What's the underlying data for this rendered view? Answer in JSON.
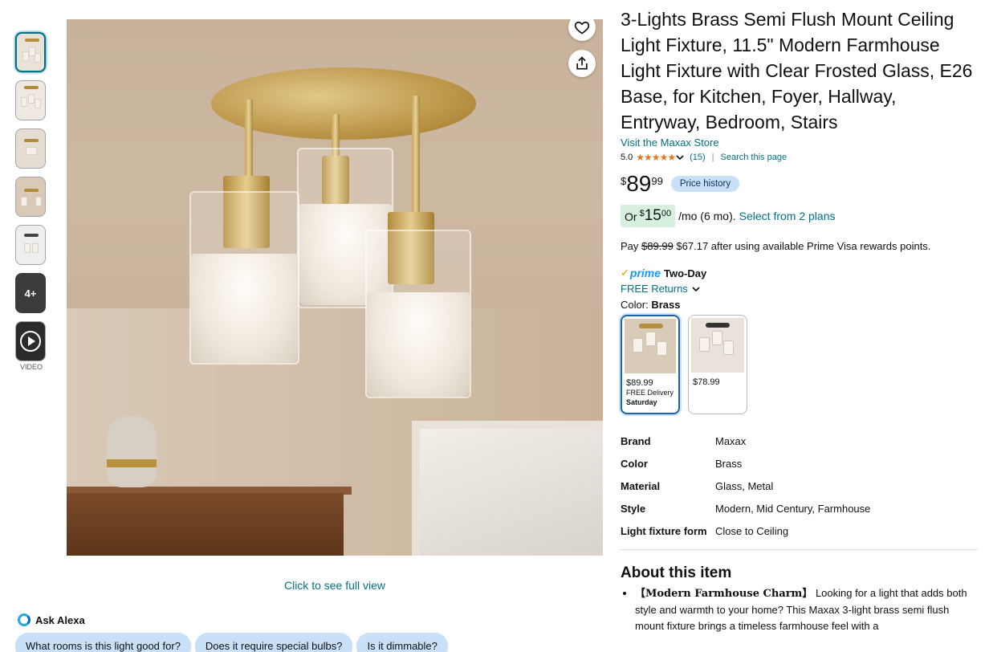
{
  "gallery": {
    "thumbnail_more": "4+",
    "video_label": "VIDEO",
    "full_view_link": "Click to see full view"
  },
  "alexa": {
    "title": "Ask Alexa",
    "questions": [
      "What rooms is this light good for?",
      "Does it require special bulbs?",
      "Is it dimmable?"
    ]
  },
  "product": {
    "title": "3-Lights Brass Semi Flush Mount Ceiling Light Fixture, 11.5\" Modern Farmhouse Light Fixture with Clear Frosted Glass, E26 Base, for Kitchen, Foyer, Hallway, Entryway, Bedroom, Stairs",
    "store_link": "Visit the Maxax Store",
    "rating": "5.0",
    "stars": "★★★★★",
    "rating_count": "(15)",
    "search_link": "Search this page"
  },
  "price": {
    "symbol": "$",
    "whole": "89",
    "fraction": "99",
    "history_button": "Price history"
  },
  "plan": {
    "or": "Or",
    "symbol": "$",
    "whole": "15",
    "fraction": "00",
    "rest": "/mo (6 mo).",
    "link": "Select from 2 plans"
  },
  "prime_rewards": {
    "pay": "Pay",
    "original": "$89.99",
    "after": "$67.17 after using available Prime Visa rewards points."
  },
  "delivery": {
    "prime_label": "prime",
    "speed": "Two-Day",
    "returns": "FREE Returns"
  },
  "color": {
    "label": "Color:",
    "value": "Brass",
    "options": [
      {
        "price": "$89.99",
        "delivery": "FREE Delivery",
        "day": "Saturday"
      },
      {
        "price": "$78.99",
        "delivery": "",
        "day": ""
      }
    ]
  },
  "specs": [
    {
      "key": "Brand",
      "value": "Maxax"
    },
    {
      "key": "Color",
      "value": "Brass"
    },
    {
      "key": "Material",
      "value": "Glass, Metal"
    },
    {
      "key": "Style",
      "value": "Modern, Mid Century, Farmhouse"
    },
    {
      "key": "Light fixture form",
      "value": "Close to Ceiling"
    }
  ],
  "about": {
    "title": "About this item",
    "bullets": [
      {
        "head": "【Modern Farmhouse Charm】",
        "text": "Looking for a light that adds both style and warmth to your home? This Maxax 3-light brass semi flush mount fixture brings a timeless farmhouse feel with a"
      }
    ]
  },
  "colors": {
    "link": "#007185",
    "price_history_bg": "#c8e0f8",
    "plan_bg": "#d7f0dd",
    "star": "#de7921",
    "prime": "#1399ff",
    "brass": "#b58e40"
  }
}
